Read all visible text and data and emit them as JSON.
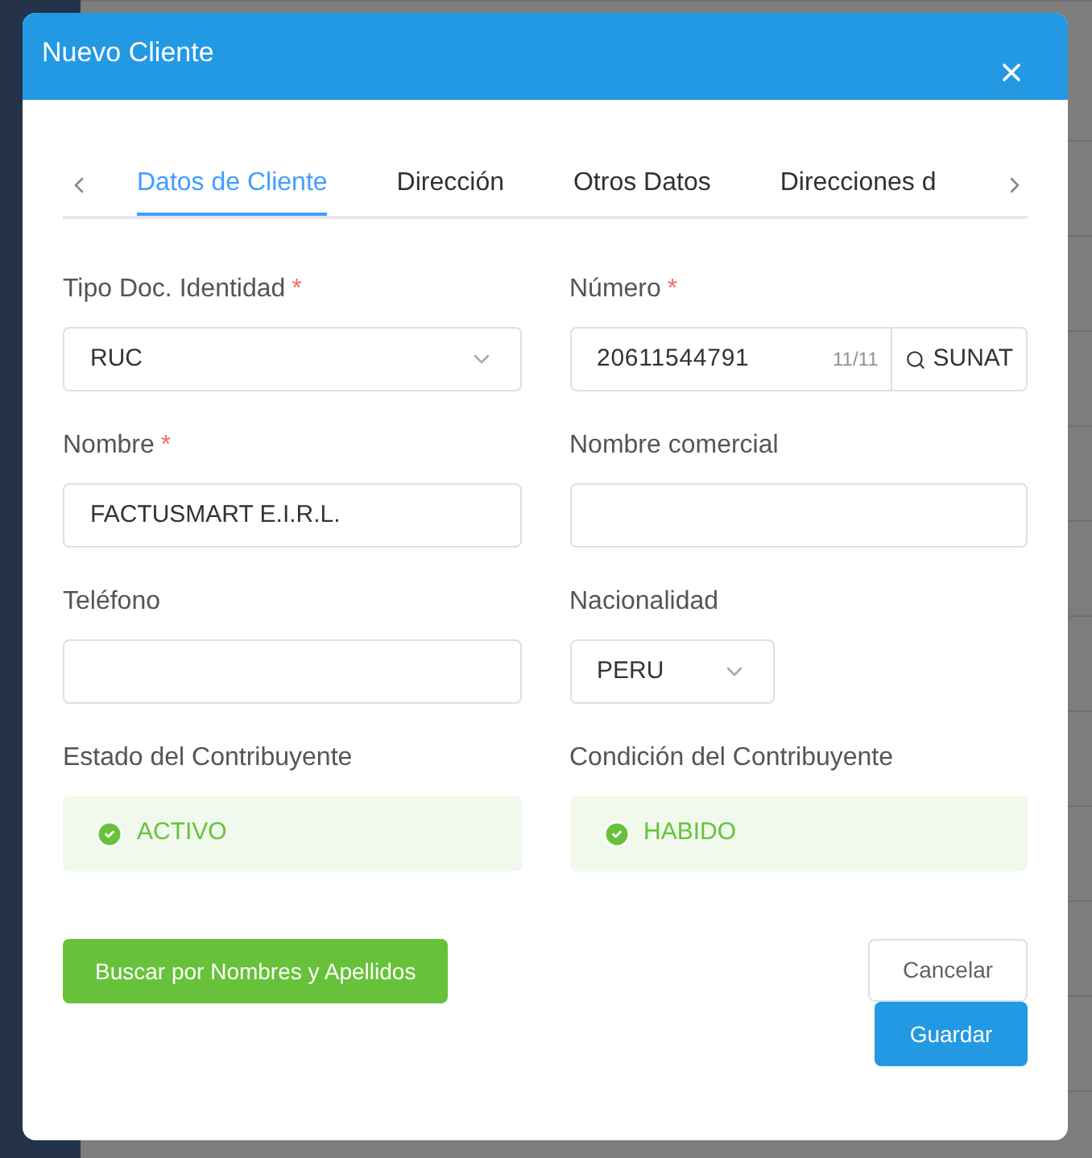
{
  "dialog": {
    "title": "Nuevo Cliente",
    "required_mark": "*",
    "tabs": [
      {
        "label": "Datos de Cliente",
        "selected": true
      },
      {
        "label": "Dirección",
        "selected": false
      },
      {
        "label": "Otros Datos",
        "selected": false
      },
      {
        "label": "Direcciones d",
        "selected": false
      }
    ],
    "fields": [
      {
        "kind": "select",
        "label": "Tipo Doc. Identidad",
        "required": true,
        "value": "RUC"
      },
      {
        "kind": "lookup",
        "label": "Número",
        "required": true,
        "value": "20611544791",
        "counter": "11/11",
        "button": "SUNAT"
      },
      {
        "kind": "text",
        "label": "Nombre",
        "required": true,
        "value": "FACTUSMART E.I.R.L."
      },
      {
        "kind": "text",
        "label": "Nombre comercial",
        "required": false
      },
      {
        "kind": "text",
        "label": "Teléfono",
        "required": false
      },
      {
        "kind": "small-select",
        "label": "Nacionalidad",
        "required": false,
        "value": "PERU"
      },
      {
        "kind": "status",
        "label": "Estado del Contribuyente",
        "value": "ACTIVO"
      },
      {
        "kind": "status",
        "label": "Condición del Contribuyente",
        "value": "HABIDO"
      }
    ],
    "search_button": "Buscar por Nombres y Apellidos",
    "cancel_button": "Cancelar",
    "save_button": "Guardar"
  }
}
